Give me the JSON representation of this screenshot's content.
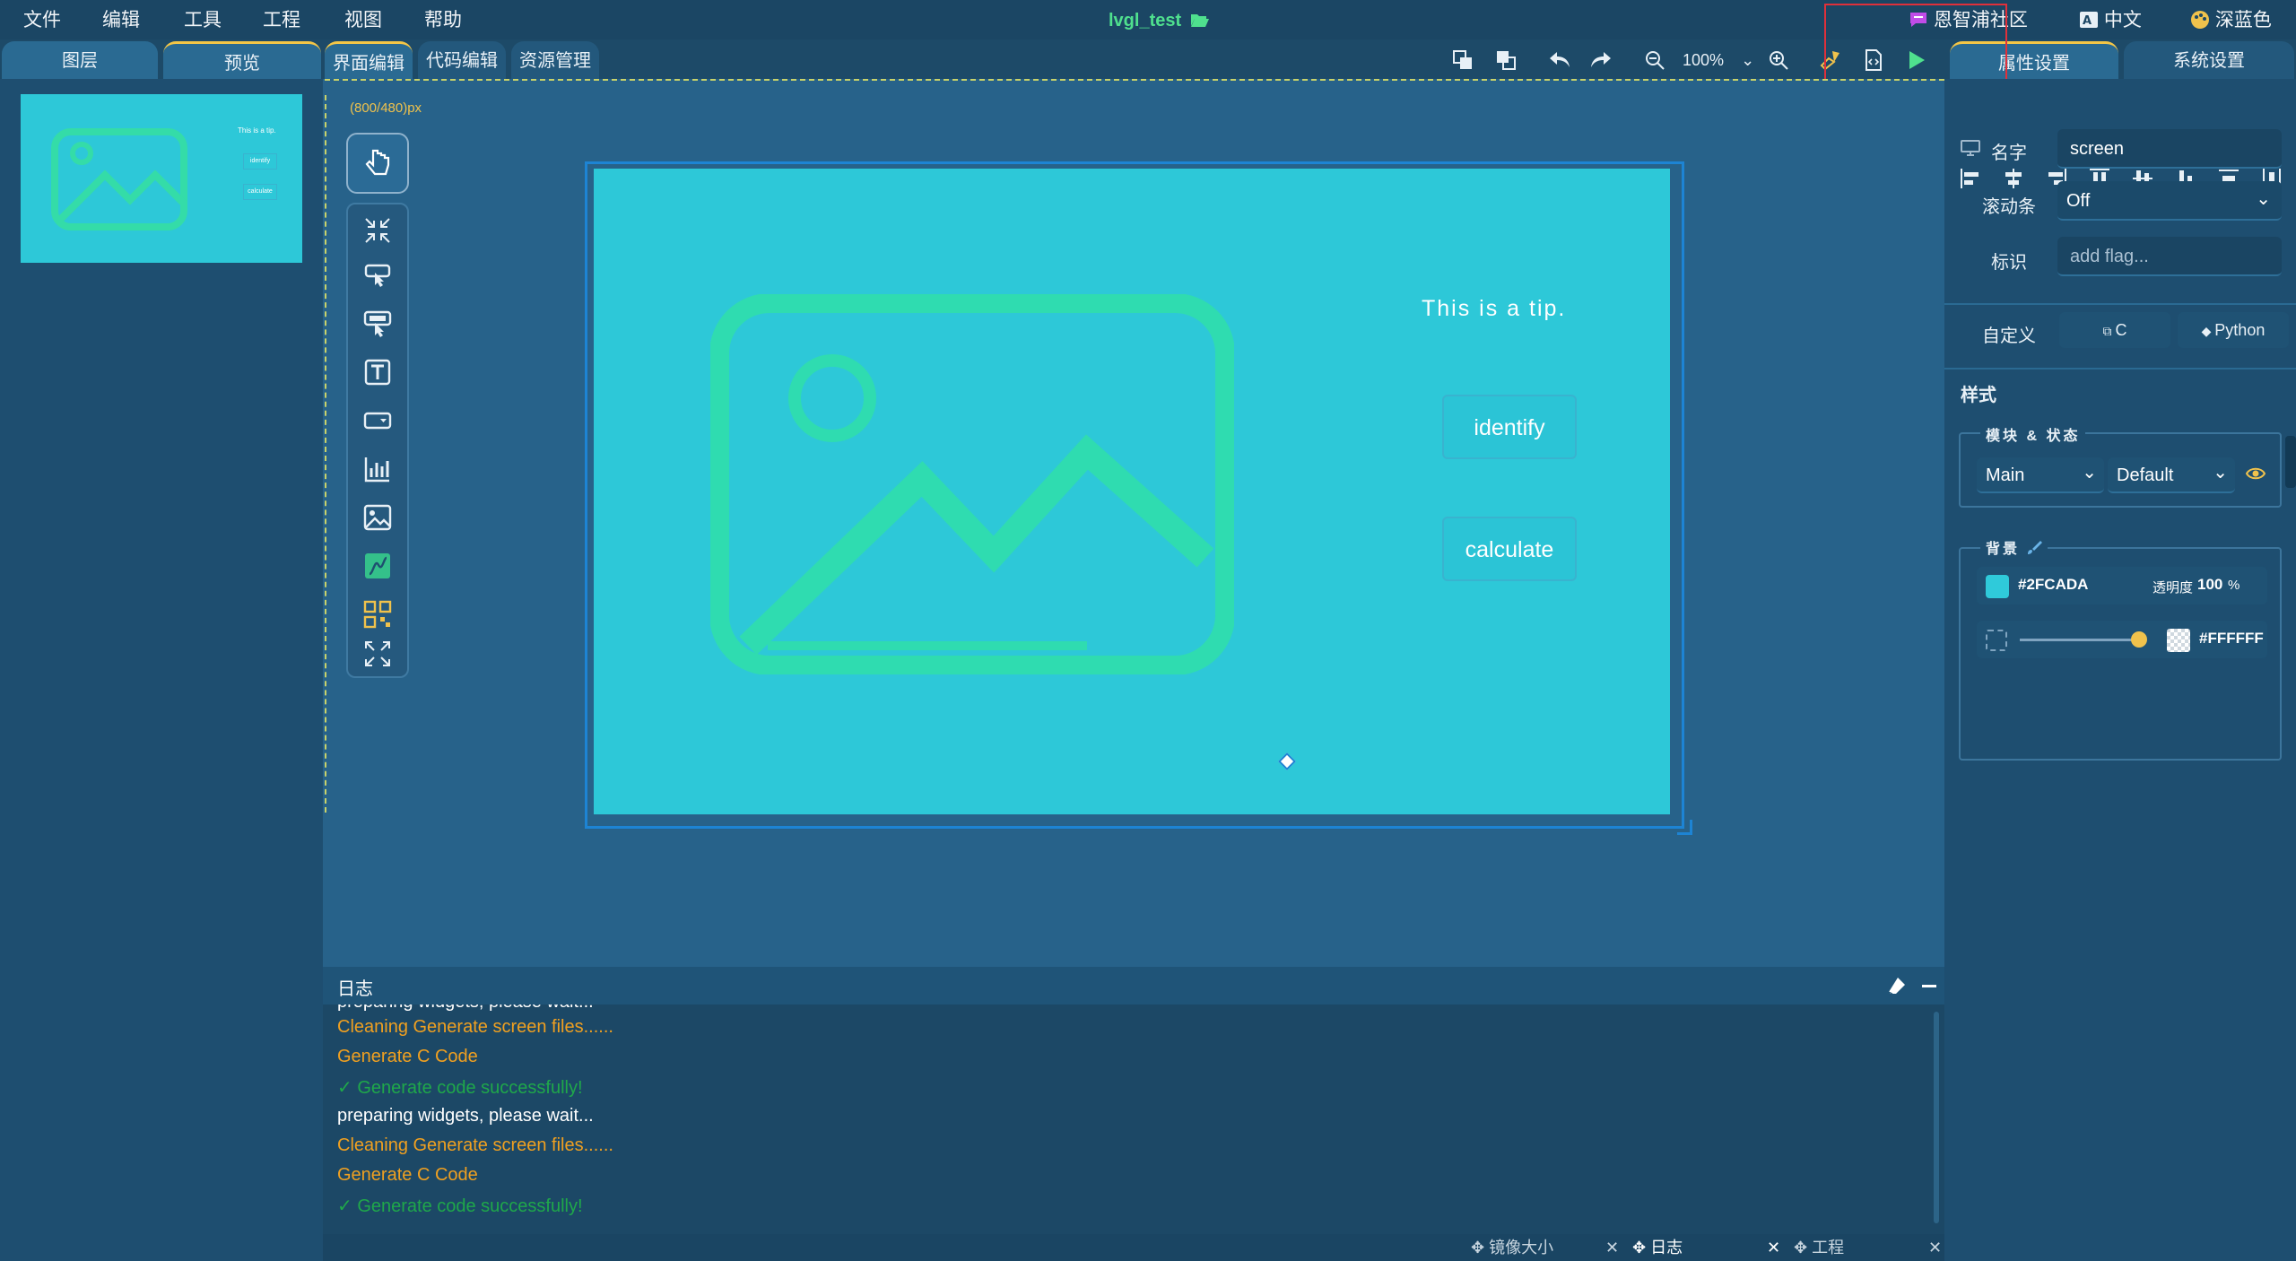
{
  "menu": {
    "items": [
      "文件",
      "编辑",
      "工具",
      "工程",
      "视图",
      "帮助"
    ],
    "project_title": "lvgl_test",
    "community": "恩智浦社区",
    "language": "中文",
    "theme": "深蓝色"
  },
  "left_tabs": {
    "layers": "图层",
    "preview": "预览"
  },
  "center_tabs": {
    "ui_editor": "界面编辑",
    "code_editor": "代码编辑",
    "resource_manager": "资源管理"
  },
  "toolbar": {
    "zoom_level": "100%"
  },
  "right_tabs": {
    "properties": "属性设置",
    "system": "系统设置"
  },
  "canvas": {
    "size_label": "(800/480)px"
  },
  "screen": {
    "background": "#2DC8D8",
    "tip": "This is a tip.",
    "thumb_tip": "This is a tip.",
    "button1": "identify",
    "button2": "calculate"
  },
  "properties": {
    "name_label": "名字",
    "name_value": "screen",
    "scrollbar_label": "滚动条",
    "scrollbar_value": "Off",
    "flag_label": "标识",
    "flag_placeholder": "add flag...",
    "custom_label": "自定义",
    "custom_c": "C",
    "custom_python": "Python",
    "style_heading": "样式",
    "block_state_title": "模块 & 状态",
    "part_value": "Main",
    "state_value": "Default",
    "background_title": "背景",
    "bg_color": "#2FCADA",
    "bg_color_swatch": "#2fcada",
    "opacity_label": "透明度",
    "opacity_value": "100",
    "opacity_unit": "%",
    "grad_color": "#FFFFFF",
    "grad_slider": 0.95
  },
  "log": {
    "title": "日志",
    "lines": [
      {
        "text": "preparing widgets, please wait...",
        "color": "#ffffff"
      },
      {
        "text": "Cleaning Generate screen files......",
        "color": "#f0a020"
      },
      {
        "text": "Generate C Code",
        "color": "#f0a020"
      },
      {
        "text": "✓ Generate code successfully!",
        "color": "#1fa84a"
      },
      {
        "text": "preparing widgets, please wait...",
        "color": "#ffffff"
      },
      {
        "text": "Cleaning Generate screen files......",
        "color": "#f0a020"
      },
      {
        "text": "Generate C Code",
        "color": "#f0a020"
      },
      {
        "text": "✓ Generate code successfully!",
        "color": "#1fa84a"
      }
    ]
  },
  "bottom_tabs": {
    "mirror_size": "镜像大小",
    "log": "日志",
    "project": "工程"
  },
  "accent": {
    "play": "#4fe08e",
    "annotation": "#e0303a"
  }
}
